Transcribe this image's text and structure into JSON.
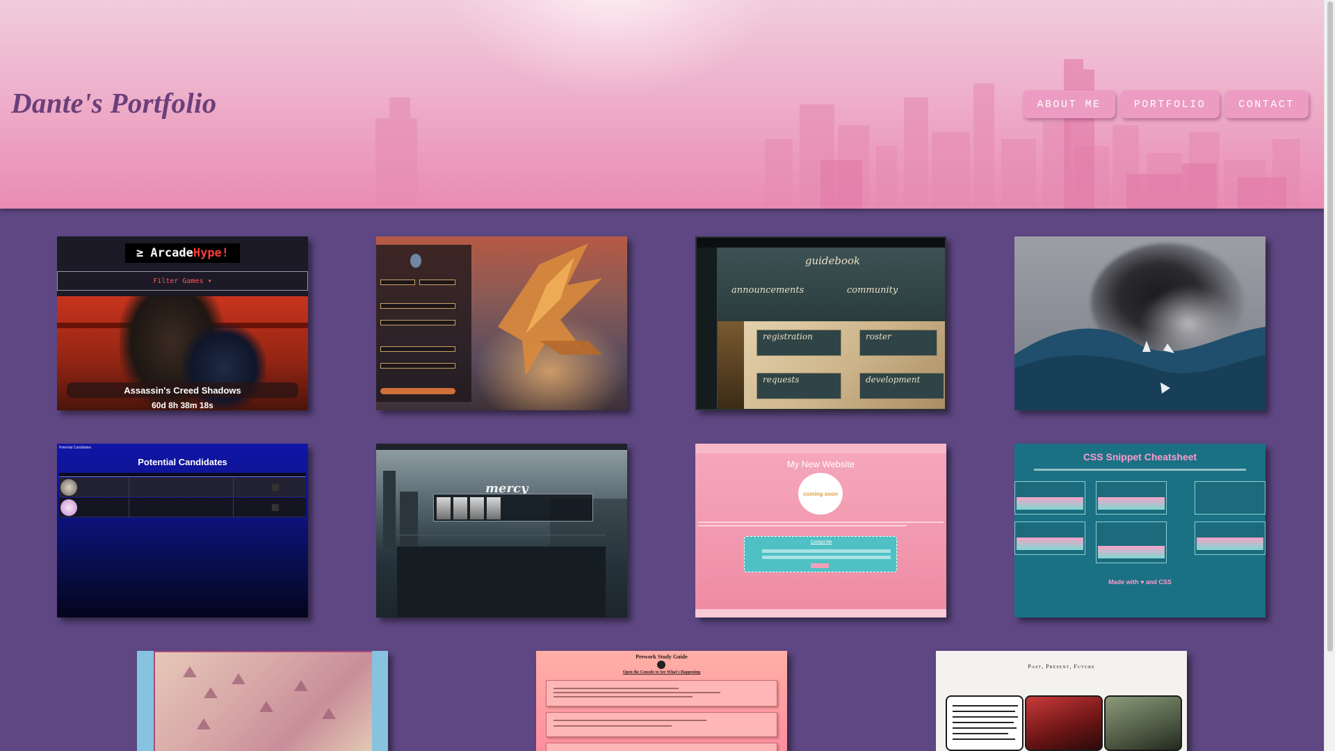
{
  "header": {
    "title": "Dante's Portfolio",
    "nav": [
      {
        "label": "ABOUT ME"
      },
      {
        "label": "PORTFOLIO"
      },
      {
        "label": "CONTACT"
      }
    ]
  },
  "projects": {
    "arcade": {
      "logo_prefix": "≥ Arcade",
      "logo_suffix": "Hype!",
      "filter_label": "Filter Games ▾",
      "game_title": "Assassin's Creed Shadows",
      "countdown": "60d 8h 38m 18s"
    },
    "guidebook": {
      "title": "guidebook",
      "left_link": "announcements",
      "right_link": "community",
      "tiles": [
        "registration",
        "roster",
        "requests",
        "development"
      ]
    },
    "candidates": {
      "tiny_label": "Potential Candidates",
      "title": "Potential Candidates"
    },
    "mercy": {
      "title": "mercy"
    },
    "website": {
      "title": "My New Website",
      "logo_text": "coming soon",
      "contact_label": "Contact Me"
    },
    "cheatsheet": {
      "title": "CSS Snippet Cheatsheet",
      "footer": "Made with ♥ and CSS"
    },
    "study": {
      "title": "Prework Study Guide",
      "subtitle": "Open the Console to See What's Happening"
    },
    "tarot": {
      "title": "Past, Present, Future"
    }
  },
  "colors": {
    "page_background": "#5e4783",
    "nav_button": "#ec9cc2",
    "title": "#6b3f7a"
  }
}
